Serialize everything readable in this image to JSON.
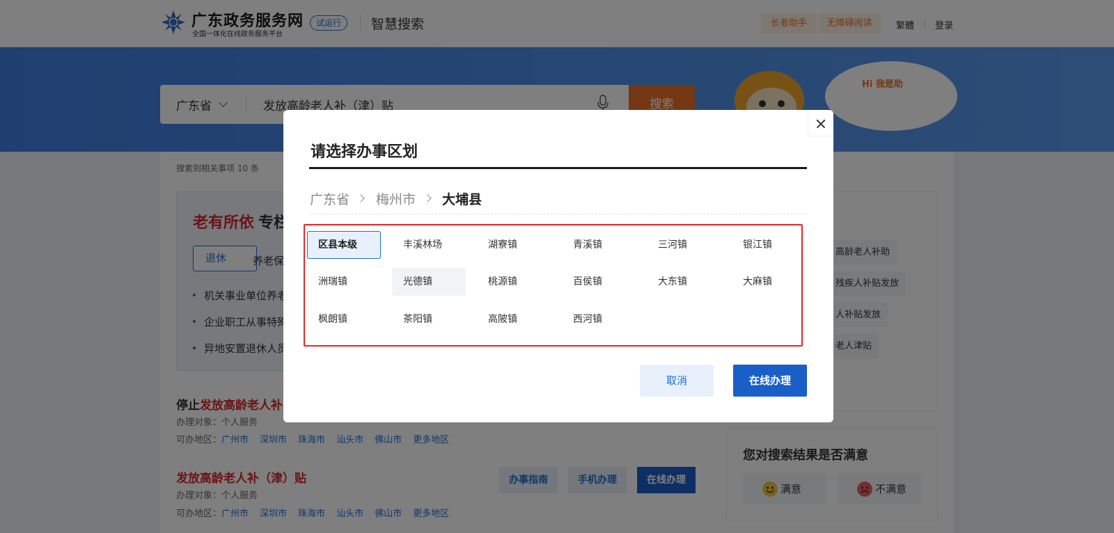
{
  "header": {
    "logo_title": "广东政务服务网",
    "logo_subtitle": "全国一体化在线政务服务平台",
    "trial_badge": "试运行",
    "app_name": "智慧搜索",
    "elder_mode": "长者助手",
    "accessible_mode": "无障碍阅读",
    "traditional": "繁體",
    "login": "登录",
    "accent_color": "#e8712a",
    "brand_color": "#1f6fd8"
  },
  "search": {
    "province": "广东省",
    "query": "发放高龄老人补（津）贴",
    "button": "搜索",
    "assistant_greeting": "Hi 我是助"
  },
  "results": {
    "count_text": "搜索到相关事项 10 条",
    "topic": {
      "title_highlight": "老有所依",
      "title_rest": "专栏",
      "tabs": [
        "退休",
        "养老保"
      ],
      "items": [
        "机关事业单位养老",
        "企业职工从事特殊",
        "异地安置退休人员"
      ]
    },
    "list": [
      {
        "title_prefix": "停止",
        "title_highlight": "发放高龄老人补",
        "target": "办理对象：个人服务",
        "regions_label": "可办地区：",
        "regions": [
          "广州市",
          "深圳市",
          "珠海市",
          "汕头市",
          "佛山市",
          "更多地区"
        ]
      },
      {
        "title_prefix": "",
        "title_highlight": "发放高龄老人补（津）贴",
        "target": "办理对象：个人服务",
        "regions_label": "可办地区：",
        "regions": [
          "广州市",
          "深圳市",
          "珠海市",
          "汕头市",
          "佛山市",
          "更多地区"
        ],
        "buttons": [
          "办事指南",
          "手机办理",
          "在线办理"
        ]
      }
    ]
  },
  "sidebar": {
    "tags": [
      "高龄老人补助",
      "残疾人补贴发放",
      "人补贴发放",
      "老人津贴"
    ]
  },
  "feedback": {
    "title": "您对搜索结果是否满意",
    "satisfied": "满意",
    "unsatisfied": "不满意"
  },
  "dialog": {
    "title": "请选择办事区划",
    "breadcrumb": [
      "广东省",
      "梅州市",
      "大埔县"
    ],
    "towns": [
      "区县本级",
      "丰溪林场",
      "湖寮镇",
      "青溪镇",
      "三河镇",
      "银江镇",
      "洲瑞镇",
      "光德镇",
      "桃源镇",
      "百侯镇",
      "大东镇",
      "大麻镇",
      "枫朗镇",
      "茶阳镇",
      "高陂镇",
      "西河镇"
    ],
    "selected_town": "区县本级",
    "cancel": "取消",
    "confirm": "在线办理"
  }
}
